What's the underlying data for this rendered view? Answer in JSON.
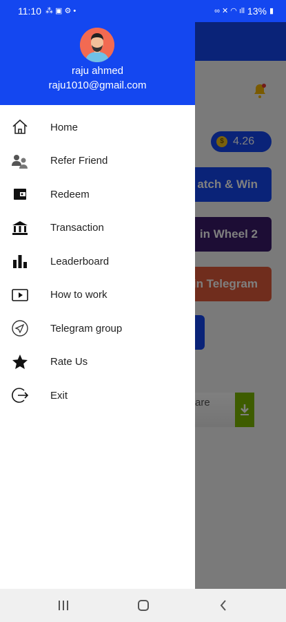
{
  "status_bar": {
    "time": "11:10",
    "battery": "13%"
  },
  "background_app": {
    "coin_balance": "4.26",
    "cards": [
      "atch & Win",
      "in Wheel 2",
      "in Telegram"
    ],
    "share_text": "are"
  },
  "drawer": {
    "user_name": "raju ahmed",
    "user_email": "raju1010@gmail.com",
    "items": [
      {
        "label": "Home",
        "icon": "home-icon"
      },
      {
        "label": "Refer Friend",
        "icon": "refer-friend-icon"
      },
      {
        "label": "Redeem",
        "icon": "wallet-icon"
      },
      {
        "label": "Transaction",
        "icon": "bank-icon"
      },
      {
        "label": "Leaderboard",
        "icon": "bar-chart-icon"
      },
      {
        "label": "How to work",
        "icon": "play-video-icon"
      },
      {
        "label": "Telegram group",
        "icon": "telegram-icon"
      },
      {
        "label": "Rate Us",
        "icon": "star-icon"
      },
      {
        "label": "Exit",
        "icon": "exit-icon"
      }
    ]
  },
  "colors": {
    "primary": "#1447f0",
    "avatar_bg": "#f26a52"
  }
}
